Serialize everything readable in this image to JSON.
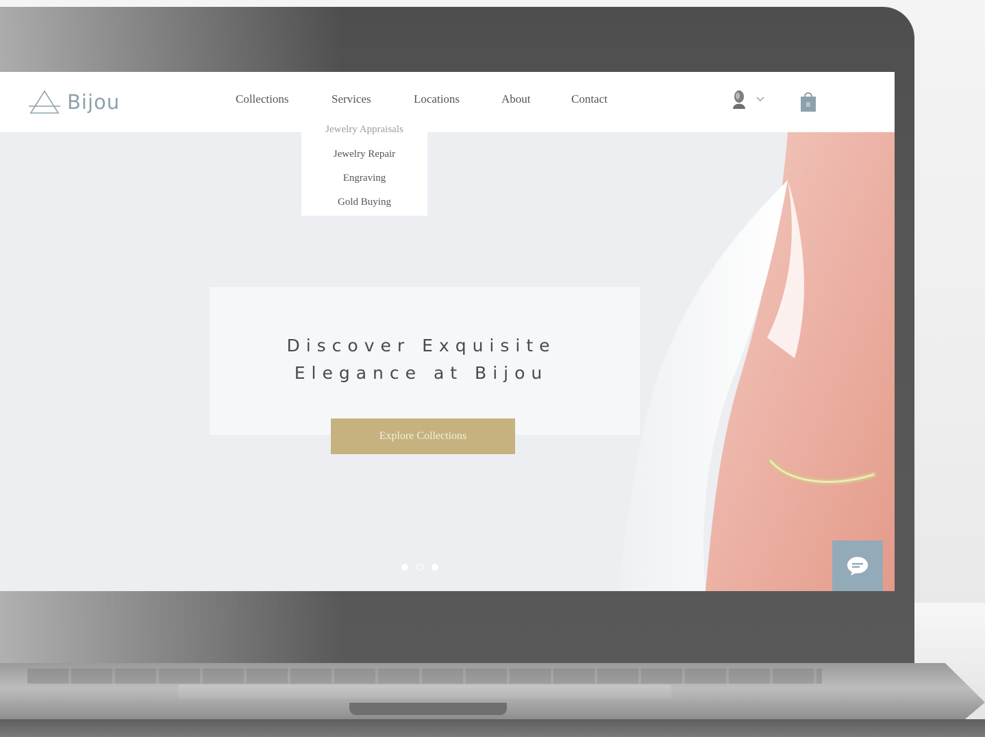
{
  "brand": {
    "name": "Bijou"
  },
  "nav": {
    "items": [
      {
        "label": "Collections"
      },
      {
        "label": "Services"
      },
      {
        "label": "Locations"
      },
      {
        "label": "About"
      },
      {
        "label": "Contact"
      }
    ]
  },
  "services_dropdown": {
    "items": [
      {
        "label": "Jewelry Appraisals",
        "active": true
      },
      {
        "label": "Jewelry Repair"
      },
      {
        "label": "Engraving"
      },
      {
        "label": "Gold Buying"
      }
    ]
  },
  "hero": {
    "title_line1": "Discover Exquisite",
    "title_line2": "Elegance at Bijou",
    "cta_label": "Explore Collections",
    "slides": {
      "count": 3,
      "active_index": 1
    }
  },
  "icons": {
    "logo": "triangle-logo-icon",
    "account": "user-avatar-icon",
    "account_menu": "chevron-down-icon",
    "cart": "shopping-bag-icon",
    "chat": "chat-bubble-icon"
  },
  "colors": {
    "accent_gold": "#c6b27f",
    "logo_blue_gray": "#8da0ad",
    "chat_button": "#93aab8",
    "header_bg": "#ffffff",
    "page_bg": "#eceef1"
  }
}
